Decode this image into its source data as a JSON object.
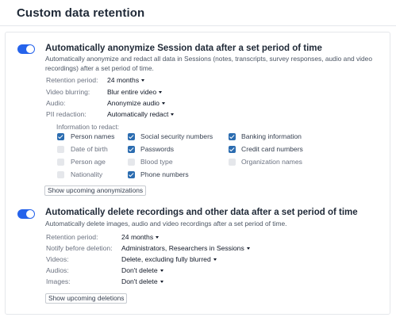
{
  "title": "Custom data retention",
  "anonymize": {
    "title": "Automatically anonymize Session data after a set period of time",
    "description": "Automatically anonymize and redact all data in Sessions (notes, transcripts, survey responses, audio and video recordings) after a set period of time.",
    "enabled": true,
    "settings": [
      {
        "label": "Retention period:",
        "value": "24 months"
      },
      {
        "label": "Video blurring:",
        "value": "Blur entire video"
      },
      {
        "label": "Audio:",
        "value": "Anonymize audio"
      },
      {
        "label": "PII redaction:",
        "value": "Automatically redact"
      }
    ],
    "redact_heading": "Information to redact:",
    "redact_items": [
      {
        "label": "Person names",
        "checked": true
      },
      {
        "label": "Social security numbers",
        "checked": true
      },
      {
        "label": "Banking information",
        "checked": true
      },
      {
        "label": "Date of birth",
        "checked": false
      },
      {
        "label": "Passwords",
        "checked": true
      },
      {
        "label": "Credit card numbers",
        "checked": true
      },
      {
        "label": "Person age",
        "checked": false
      },
      {
        "label": "Blood type",
        "checked": false
      },
      {
        "label": "Organization names",
        "checked": false
      },
      {
        "label": "Nationality",
        "checked": false
      },
      {
        "label": "Phone numbers",
        "checked": true
      }
    ],
    "button_label": "Show upcoming anonymizations"
  },
  "delete": {
    "title": "Automatically delete recordings and other data after a set period of time",
    "description": "Automatically delete images, audio and video recordings after a set period of time.",
    "enabled": true,
    "settings": [
      {
        "label": "Retention period:",
        "value": "24 months"
      },
      {
        "label": "Notify before deletion:",
        "value": "Administrators, Researchers in Sessions"
      },
      {
        "label": "Videos:",
        "value": "Delete, excluding fully blurred"
      },
      {
        "label": "Audios:",
        "value": "Don't delete"
      },
      {
        "label": "Images:",
        "value": "Don't delete"
      }
    ],
    "button_label": "Show upcoming deletions"
  },
  "colors": {
    "accent": "#2563eb",
    "checkbox_on": "#2b6cb0",
    "checkbox_off": "#e5e7eb",
    "border": "#e5e7eb"
  }
}
